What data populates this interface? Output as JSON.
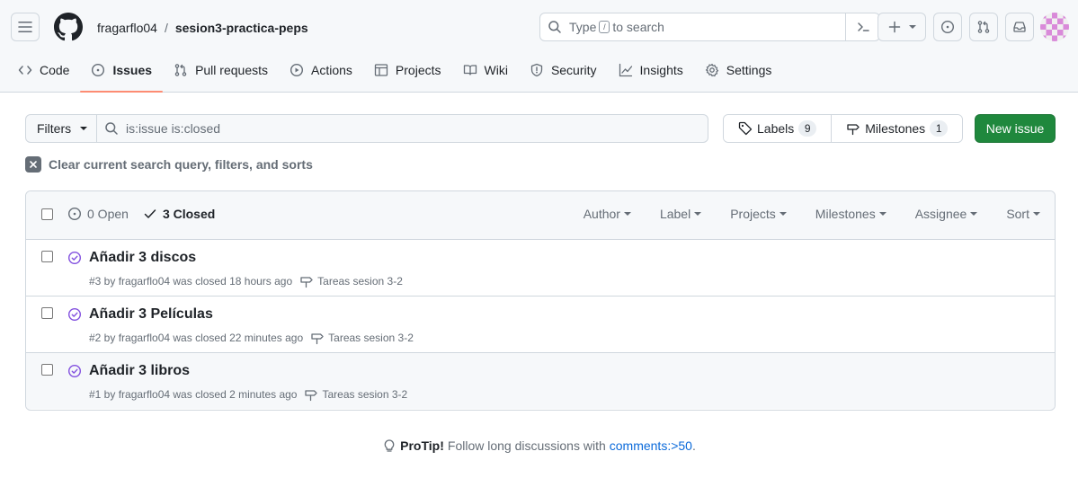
{
  "header": {
    "owner": "fragarflo04",
    "separator": "/",
    "repo": "sesion3-practica-peps",
    "search_placeholder_pre": "Type",
    "search_placeholder_key": "/",
    "search_placeholder_post": "to search"
  },
  "tabs": [
    {
      "label": "Code",
      "icon": "code-icon"
    },
    {
      "label": "Issues",
      "icon": "issue-opened-icon",
      "active": true
    },
    {
      "label": "Pull requests",
      "icon": "git-pull-request-icon"
    },
    {
      "label": "Actions",
      "icon": "play-icon"
    },
    {
      "label": "Projects",
      "icon": "table-icon"
    },
    {
      "label": "Wiki",
      "icon": "book-icon"
    },
    {
      "label": "Security",
      "icon": "shield-icon"
    },
    {
      "label": "Insights",
      "icon": "graph-icon"
    },
    {
      "label": "Settings",
      "icon": "gear-icon"
    }
  ],
  "filters": {
    "button_label": "Filters",
    "query": "is:issue is:closed",
    "labels_label": "Labels",
    "labels_count": "9",
    "milestones_label": "Milestones",
    "milestones_count": "1",
    "new_issue_label": "New issue",
    "clear_label": "Clear current search query, filters, and sorts"
  },
  "list_header": {
    "open_label": "0 Open",
    "closed_label": "3 Closed",
    "author": "Author",
    "label": "Label",
    "projects": "Projects",
    "milestones": "Milestones",
    "assignee": "Assignee",
    "sort": "Sort"
  },
  "issues": [
    {
      "title": "Añadir 3 discos",
      "meta": "#3 by fragarflo04 was closed 18 hours ago",
      "milestone": "Tareas sesion 3-2"
    },
    {
      "title": "Añadir 3 Películas",
      "meta": "#2 by fragarflo04 was closed 22 minutes ago",
      "milestone": "Tareas sesion 3-2"
    },
    {
      "title": "Añadir 3 libros",
      "meta": "#1 by fragarflo04 was closed 2 minutes ago",
      "milestone": "Tareas sesion 3-2"
    }
  ],
  "protip": {
    "label": "ProTip!",
    "text": "Follow long discussions with",
    "link": "comments:>50",
    "end": "."
  },
  "colors": {
    "accent_green": "#1f883d",
    "closed_purple": "#8250df",
    "tab_underline": "#fd8c73",
    "link_blue": "#0969da"
  }
}
